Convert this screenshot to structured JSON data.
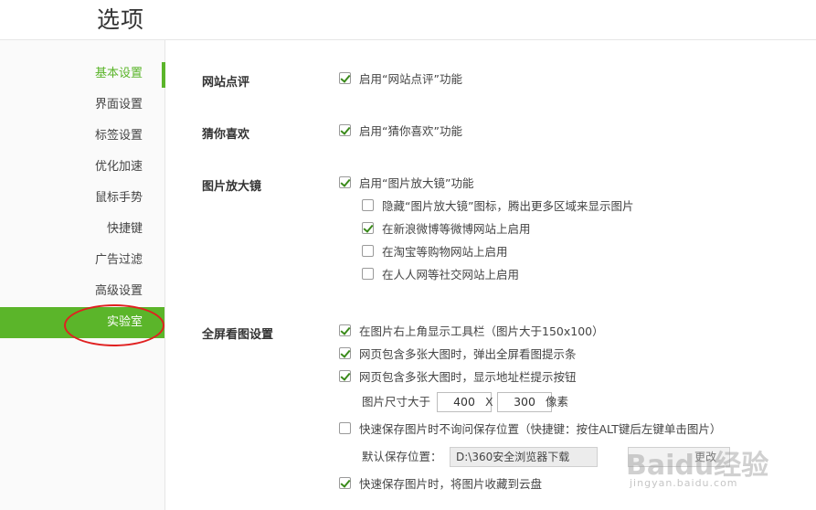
{
  "header": {
    "title": "选项"
  },
  "sidebar": {
    "items": [
      {
        "label": "基本设置"
      },
      {
        "label": "界面设置"
      },
      {
        "label": "标签设置"
      },
      {
        "label": "优化加速"
      },
      {
        "label": "鼠标手势"
      },
      {
        "label": "快捷键"
      },
      {
        "label": "广告过滤"
      },
      {
        "label": "高级设置"
      },
      {
        "label": "实验室"
      }
    ],
    "selected": "基本设置",
    "highlighted": "实验室"
  },
  "sections": {
    "site_review": {
      "title": "网站点评",
      "options": [
        {
          "label": "启用“网站点评”功能",
          "checked": true
        }
      ]
    },
    "guess_like": {
      "title": "猜你喜欢",
      "options": [
        {
          "label": "启用“猜你喜欢”功能",
          "checked": true
        }
      ]
    },
    "magnifier": {
      "title": "图片放大镜",
      "options": [
        {
          "label": "启用“图片放大镜”功能",
          "checked": true
        },
        {
          "label": "隐藏“图片放大镜”图标，腾出更多区域来显示图片",
          "checked": false
        },
        {
          "label": "在新浪微博等微博网站上启用",
          "checked": true
        },
        {
          "label": "在淘宝等购物网站上启用",
          "checked": false
        },
        {
          "label": "在人人网等社交网站上启用",
          "checked": false
        }
      ]
    },
    "fullscreen": {
      "title": "全屏看图设置",
      "options": [
        {
          "label": "在图片右上角显示工具栏（图片大于150x100）",
          "checked": true
        },
        {
          "label": "网页包含多张大图时，弹出全屏看图提示条",
          "checked": true
        },
        {
          "label": "网页包含多张大图时，显示地址栏提示按钮",
          "checked": true
        },
        {
          "label": "快速保存图片时不询问保存位置（快捷键：按住ALT键后左键单击图片）",
          "checked": false
        },
        {
          "label": "快速保存图片时，将图片收藏到云盘",
          "checked": true
        }
      ],
      "size_label": "图片尺寸大于",
      "width": "400",
      "times": "X",
      "height": "300",
      "unit": "像素",
      "save_location_label": "默认保存位置：",
      "save_path": "D:\\360安全浏览器下载",
      "change_button": "更改"
    }
  },
  "watermark": {
    "text": "Baidu经验",
    "sub": "jingyan.baidu.com"
  },
  "colors": {
    "accent": "#5bb52a",
    "annotation": "#e02020"
  }
}
